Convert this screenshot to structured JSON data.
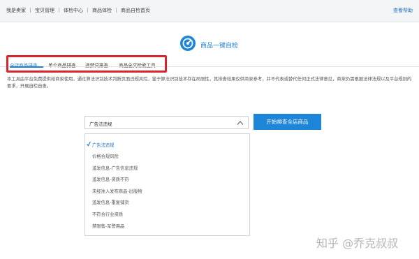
{
  "breadcrumb": {
    "items": [
      "我是卖家",
      "宝贝管理",
      "体检中心",
      "商品体检",
      "商品自检首页"
    ]
  },
  "header": {
    "help_link": "查看帮助"
  },
  "page": {
    "title": "商品一键自检"
  },
  "tabs": [
    {
      "label": "全店商品排查",
      "active": true
    },
    {
      "label": "单个商品排查",
      "active": false
    },
    {
      "label": "违禁词排查",
      "active": false
    },
    {
      "label": "商品全文检索工具",
      "active": false
    }
  ],
  "description": "本工具由平台免费提供给商家使用，通过算法识别技术判断页面违规风险，鉴于算法识别技术存在局限性，其排查结果仅供商家参考，并不代表或替代任何正式法律意见，商家仍需根据法律法规以及平台规则的要求，开展自检自查。",
  "filter": {
    "selected": "广告法违规",
    "options": [
      {
        "label": "广告法违规",
        "selected": true
      },
      {
        "label": "价格合规风险",
        "selected": false
      },
      {
        "label": "滥发信息-广告信息违规",
        "selected": false
      },
      {
        "label": "滥发信息-资质不符",
        "selected": false
      },
      {
        "label": "未经准入发布商品-出版物",
        "selected": false
      },
      {
        "label": "滥发信息-重复铺货",
        "selected": false
      },
      {
        "label": "不符合行业资质",
        "selected": false
      },
      {
        "label": "禁限售-军警用品",
        "selected": false
      }
    ]
  },
  "actions": {
    "start_button": "开始排查全店商品"
  },
  "watermark": "知乎 @乔克叔叔",
  "colors": {
    "accent": "#1d7fd6",
    "button": "#1d86d8",
    "annotation": "#d9262c",
    "topbar": "#f4f5f7"
  }
}
